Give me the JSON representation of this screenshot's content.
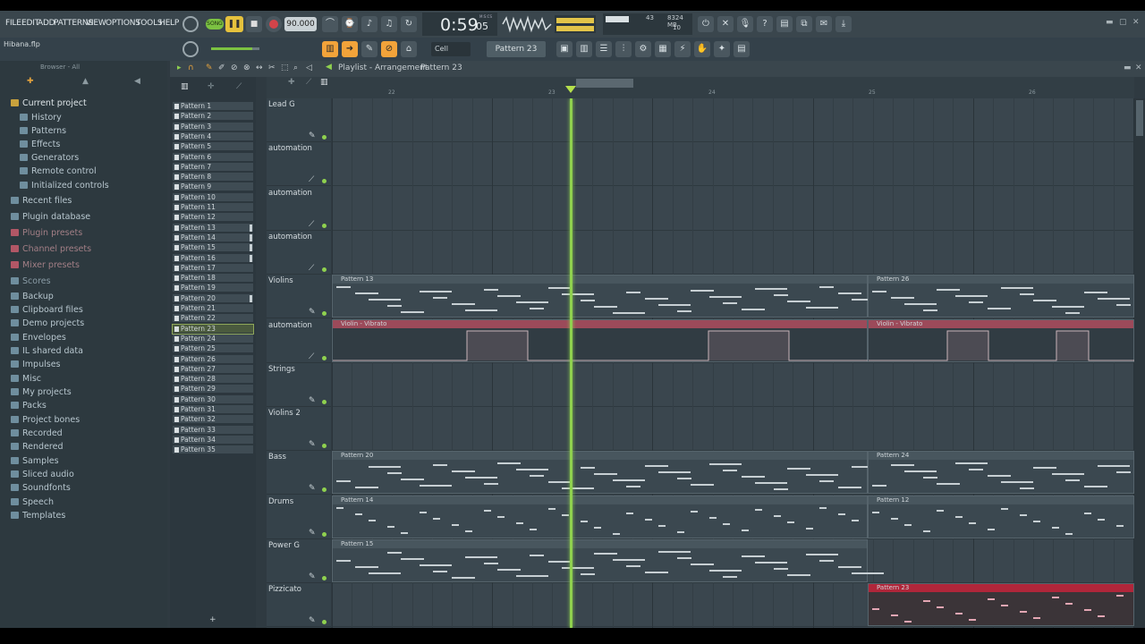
{
  "menu": [
    "FILE",
    "EDIT",
    "ADD",
    "PATTERNS",
    "VIEW",
    "OPTIONS",
    "TOOLS",
    "HELP"
  ],
  "transport": {
    "mode": "SONG",
    "tempo": "90.000",
    "time": "0:59",
    "time_sub": "05",
    "time_unit": "M:S:CS",
    "cpu": "43",
    "mem": "8324 MB",
    "poly": "10"
  },
  "toolbar": {
    "snap": "Cell",
    "pattern": "Pattern 23"
  },
  "project_file": "Hibana.flp",
  "browser": {
    "header": "Browser - All",
    "items": [
      {
        "label": "Current project",
        "icon": "project-icon"
      },
      {
        "label": "History",
        "icon": "history-icon"
      },
      {
        "label": "Patterns",
        "icon": "patterns-icon"
      },
      {
        "label": "Effects",
        "icon": "effects-icon"
      },
      {
        "label": "Generators",
        "icon": "generators-icon"
      },
      {
        "label": "Remote control",
        "icon": "remote-icon"
      },
      {
        "label": "Initialized controls",
        "icon": "controls-icon"
      },
      {
        "label": "Recent files",
        "icon": "folder-icon"
      },
      {
        "label": "Plugin database",
        "icon": "plugin-icon"
      },
      {
        "label": "Plugin presets",
        "icon": "plugin-icon"
      },
      {
        "label": "Channel presets",
        "icon": "preset-icon"
      },
      {
        "label": "Mixer presets",
        "icon": "preset-icon"
      },
      {
        "label": "Scores",
        "icon": "score-icon"
      },
      {
        "label": "Backup",
        "icon": "folder-icon"
      },
      {
        "label": "Clipboard files",
        "icon": "folder-icon"
      },
      {
        "label": "Demo projects",
        "icon": "folder-icon"
      },
      {
        "label": "Envelopes",
        "icon": "folder-icon"
      },
      {
        "label": "IL shared data",
        "icon": "folder-icon"
      },
      {
        "label": "Impulses",
        "icon": "folder-icon"
      },
      {
        "label": "Misc",
        "icon": "folder-icon"
      },
      {
        "label": "My projects",
        "icon": "folder-icon"
      },
      {
        "label": "Packs",
        "icon": "folder-icon"
      },
      {
        "label": "Project bones",
        "icon": "folder-icon"
      },
      {
        "label": "Recorded",
        "icon": "folder-icon"
      },
      {
        "label": "Rendered",
        "icon": "folder-icon"
      },
      {
        "label": "Samples",
        "icon": "folder-icon"
      },
      {
        "label": "Sliced audio",
        "icon": "folder-icon"
      },
      {
        "label": "Soundfonts",
        "icon": "folder-icon"
      },
      {
        "label": "Speech",
        "icon": "folder-icon"
      },
      {
        "label": "Templates",
        "icon": "folder-icon"
      }
    ]
  },
  "patterns": [
    "Pattern 1",
    "Pattern 2",
    "Pattern 3",
    "Pattern 4",
    "Pattern 5",
    "Pattern 6",
    "Pattern 7",
    "Pattern 8",
    "Pattern 9",
    "Pattern 10",
    "Pattern 11",
    "Pattern 12",
    "Pattern 13",
    "Pattern 14",
    "Pattern 15",
    "Pattern 16",
    "Pattern 17",
    "Pattern 18",
    "Pattern 19",
    "Pattern 20",
    "Pattern 21",
    "Pattern 22",
    "Pattern 23",
    "Pattern 24",
    "Pattern 25",
    "Pattern 26",
    "Pattern 27",
    "Pattern 28",
    "Pattern 29",
    "Pattern 30",
    "Pattern 31",
    "Pattern 32",
    "Pattern 33",
    "Pattern 34",
    "Pattern 35"
  ],
  "selected_pattern": "Pattern 23",
  "playlist": {
    "title": "Playlist - Arrangement",
    "crumb": "Pattern 23",
    "bar_numbers": [
      "22",
      "23",
      "24",
      "25",
      "26"
    ]
  },
  "tracks": [
    "Lead G",
    "automation",
    "automation",
    "automation",
    "Violins",
    "automation",
    "Strings",
    "Violins 2",
    "Bass",
    "Drums",
    "Power G",
    "Pizzicato"
  ],
  "clips": [
    {
      "track": 4,
      "label": "Pattern 13"
    },
    {
      "track": 4,
      "label": "Pattern 26"
    },
    {
      "track": 5,
      "label": "Violin - Vibrato"
    },
    {
      "track": 5,
      "label": "Violin - Vibrato"
    },
    {
      "track": 8,
      "label": "Pattern 20"
    },
    {
      "track": 8,
      "label": "Pattern 24"
    },
    {
      "track": 9,
      "label": "Pattern 14"
    },
    {
      "track": 9,
      "label": "Pattern 12"
    },
    {
      "track": 10,
      "label": "Pattern 15"
    },
    {
      "track": 11,
      "label": "Pattern 23"
    }
  ],
  "colors": {
    "accent": "#f2a33a",
    "playhead": "#8fd14f",
    "selected_clip": "#b0263a",
    "automation": "#9c4a5a"
  }
}
